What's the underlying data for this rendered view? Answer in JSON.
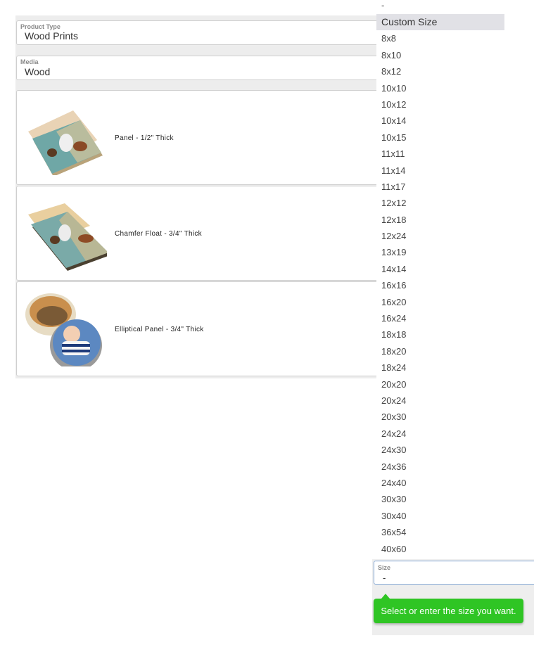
{
  "product_type": {
    "label": "Product Type",
    "value": "Wood Prints"
  },
  "media": {
    "label": "Media",
    "value": "Wood"
  },
  "options": [
    {
      "label": "Panel - 1/2\" Thick",
      "icon": "horse-panel-image"
    },
    {
      "label": "Chamfer Float - 3/4\" Thick",
      "icon": "horse-float-image"
    },
    {
      "label": "Elliptical Panel - 3/4\" Thick",
      "icon": "elliptical-panel-image"
    }
  ],
  "size_dropdown": {
    "items": [
      "-",
      "Custom Size",
      "8x8",
      "8x10",
      "8x12",
      "10x10",
      "10x12",
      "10x14",
      "10x15",
      "11x11",
      "11x14",
      "11x17",
      "12x12",
      "12x18",
      "12x24",
      "13x19",
      "14x14",
      "16x16",
      "16x20",
      "16x24",
      "18x18",
      "18x20",
      "18x24",
      "20x20",
      "20x24",
      "20x30",
      "24x24",
      "24x30",
      "24x36",
      "24x40",
      "30x30",
      "30x40",
      "36x54",
      "40x60"
    ],
    "highlighted": "Custom Size"
  },
  "size": {
    "label": "Size",
    "value": "-"
  },
  "tooltip": {
    "text": "Select or enter the size you want."
  },
  "colors": {
    "tooltip": "#2fc524",
    "highlight": "#e1e1e6",
    "focus_border": "#86a9d6"
  }
}
